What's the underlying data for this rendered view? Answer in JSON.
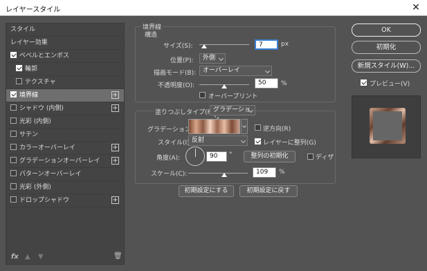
{
  "window": {
    "title": "レイヤースタイル",
    "close": "✕"
  },
  "left": {
    "items": [
      {
        "label": "スタイル"
      },
      {
        "label": "レイヤー効果"
      },
      {
        "label": "ベベルとエンボス",
        "checked": true
      },
      {
        "label": "輪郭",
        "checked": true
      },
      {
        "label": "テクスチャ",
        "checked": false
      },
      {
        "label": "境界線",
        "checked": true,
        "plus": "+"
      },
      {
        "label": "シャドウ (内側)",
        "checked": false,
        "plus": "+"
      },
      {
        "label": "光彩 (内側)",
        "checked": false
      },
      {
        "label": "サテン",
        "checked": false
      },
      {
        "label": "カラーオーバーレイ",
        "checked": false,
        "plus": "+"
      },
      {
        "label": "グラデーションオーバーレイ",
        "checked": false,
        "plus": "+"
      },
      {
        "label": "パターンオーバーレイ",
        "checked": false
      },
      {
        "label": "光彩 (外側)",
        "checked": false
      },
      {
        "label": "ドロップシャドウ",
        "checked": false,
        "plus": "+"
      }
    ],
    "fx": "fx",
    "up": "▲",
    "down": "▼",
    "trash": "🗑"
  },
  "stroke": {
    "title": "境界線",
    "structure": "構造",
    "size_label": "サイズ(S):",
    "size_value": "7",
    "size_unit": "px",
    "position_label": "位置(P):",
    "position_value": "外側",
    "blend_label": "描画モード(B):",
    "blend_value": "オーバーレイ",
    "opacity_label": "不透明度(O):",
    "opacity_value": "50",
    "opacity_unit": "%",
    "overprint": "オーバープリント",
    "filltype_label": "塗りつぶしタイプ(F):",
    "filltype_value": "グラデーション",
    "gradient_label": "グラデーション:",
    "reverse": "逆方向(R)",
    "style_label": "スタイル(I):",
    "style_value": "反射",
    "align": "レイヤーに整列(G)",
    "angle_label": "角度(A):",
    "angle_value": "90",
    "angle_unit": "°",
    "reset_align": "整列の初期化",
    "dither": "ディザ",
    "scale_label": "スケール(C):",
    "scale_value": "109",
    "scale_unit": "%",
    "make_default": "初期設定にする",
    "reset_default": "初期設定に戻す"
  },
  "right": {
    "ok": "OK",
    "reset": "初期化",
    "new_style": "新規スタイル(W)...",
    "preview": "プレビュー(V)"
  }
}
